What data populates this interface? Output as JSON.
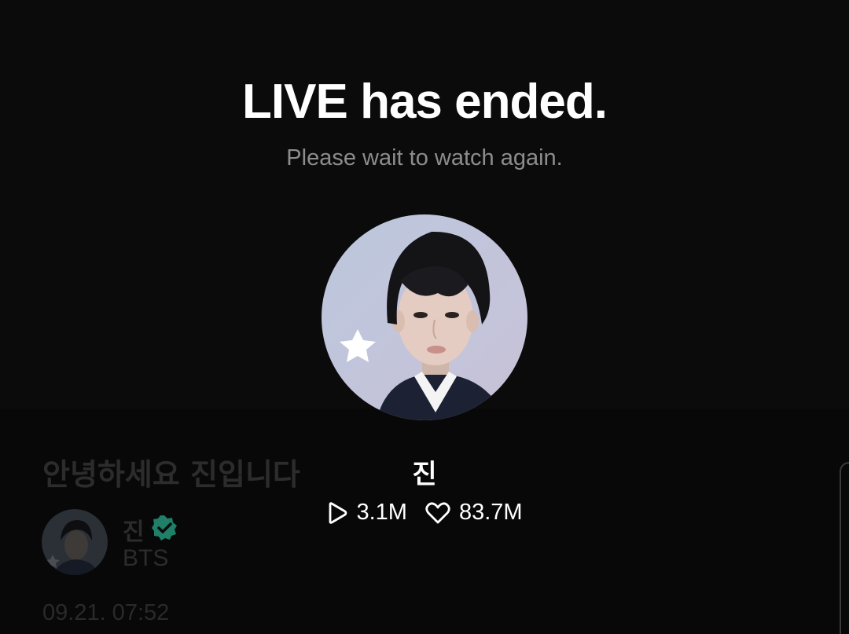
{
  "status": {
    "title": "LIVE has ended.",
    "subtitle": "Please wait to watch again."
  },
  "artist": {
    "name": "진",
    "plays": "3.1M",
    "likes": "83.7M",
    "avatar_icon": "artist-avatar"
  },
  "post": {
    "title": "안녕하세요 진입니다",
    "author_name": "진",
    "author_group": "BTS",
    "date": "09.21. 07:52",
    "verified_icon": "verified-badge-icon"
  },
  "colors": {
    "background": "#0b0b0b",
    "subtitle": "#8d8d8d",
    "dimmed_text": "#2c2c2c",
    "verified": "#1f7f68"
  }
}
